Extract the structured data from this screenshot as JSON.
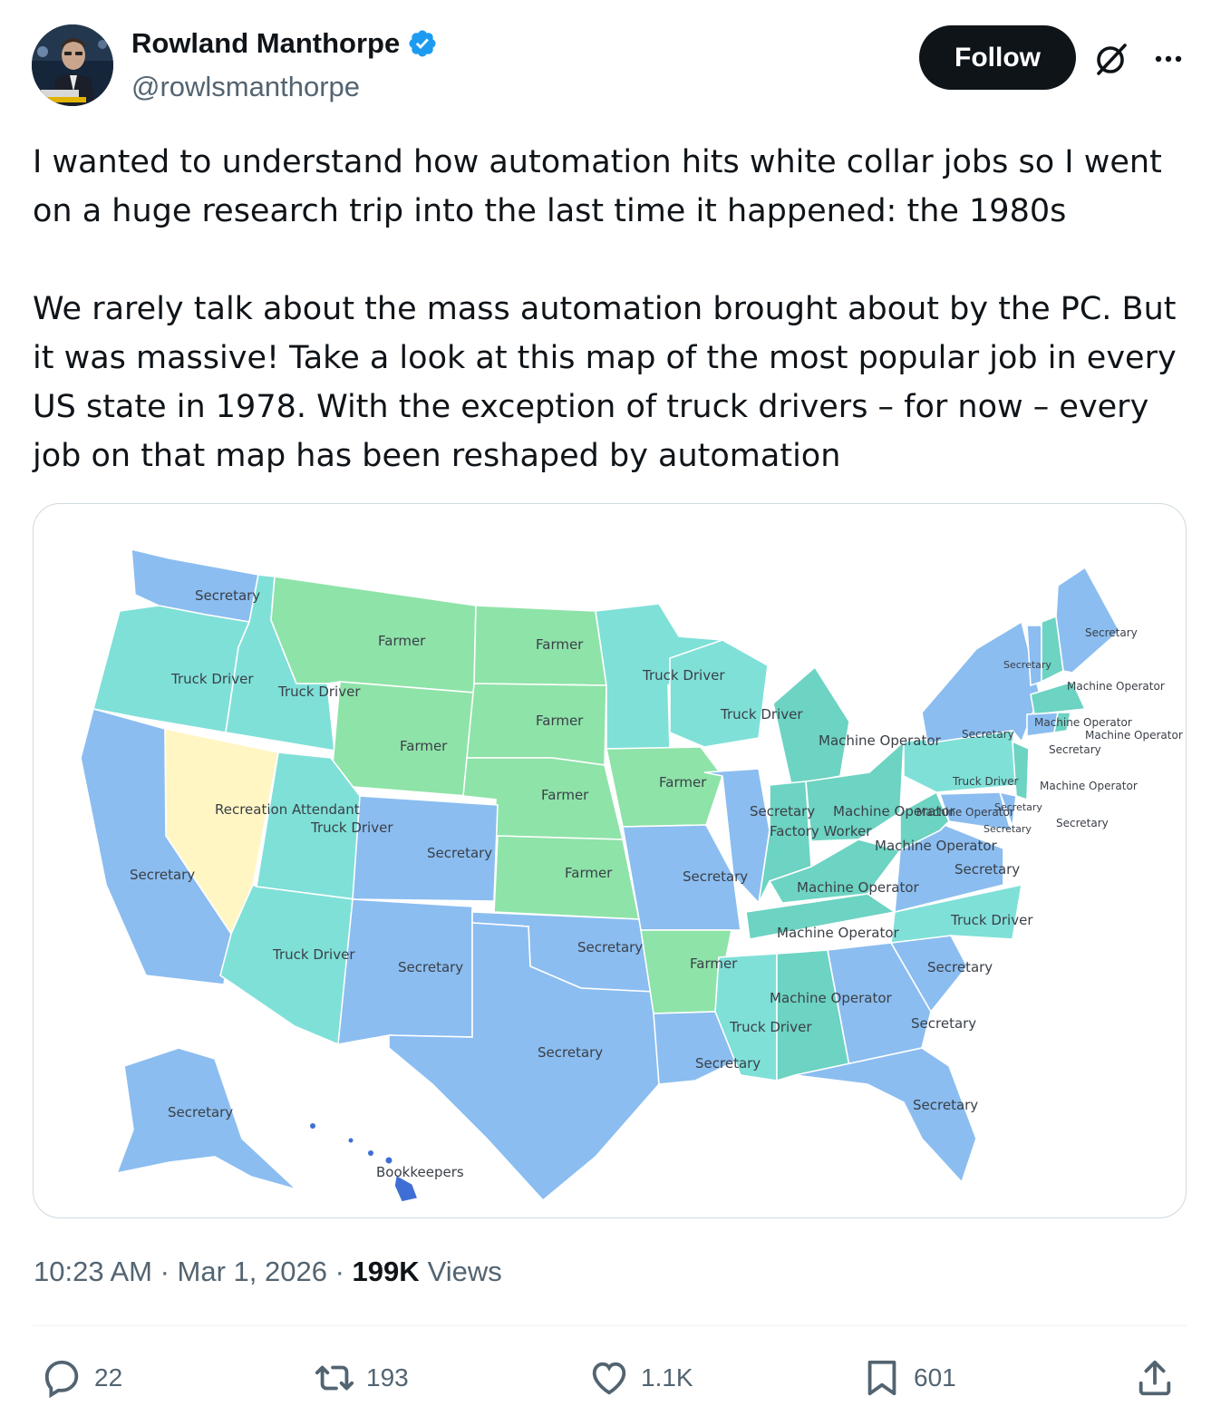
{
  "author": {
    "display_name": "Rowland Manthorpe",
    "handle": "@rowlsmanthorpe",
    "verified": true
  },
  "follow_label": "Follow",
  "tweet": {
    "paragraph_1": "I wanted to understand how automation hits white collar jobs so I went on a huge research trip into the last time it happened: the 1980s",
    "paragraph_2": "We rarely talk about the mass automation brought about by the PC. But it was massive! Take a look at this map of the most popular job in every US state in 1978. With the exception of truck drivers – for now – every job on that map has been reshaped by automation"
  },
  "map": {
    "colors": {
      "Secretary": "#8bbdf0",
      "Truck Driver": "#7fe0d8",
      "Farmer": "#8ee3a8",
      "Machine Operator": "#6dd3c2",
      "Recreation Attendant": "#fff6c4",
      "Bookkeepers": "#3f6fd4"
    },
    "labels": [
      {
        "state": "WA",
        "job": "Secretary"
      },
      {
        "state": "OR",
        "job": "Truck Driver"
      },
      {
        "state": "ID",
        "job": "Truck Driver"
      },
      {
        "state": "MT",
        "job": "Farmer"
      },
      {
        "state": "ND",
        "job": "Farmer"
      },
      {
        "state": "MN",
        "job": "Truck Driver"
      },
      {
        "state": "SD",
        "job": "Farmer"
      },
      {
        "state": "WY",
        "job": "Farmer"
      },
      {
        "state": "WI",
        "job": "Truck Driver"
      },
      {
        "state": "MI",
        "job": "Machine Operator"
      },
      {
        "state": "NE",
        "job": "Farmer"
      },
      {
        "state": "IA",
        "job": "Farmer"
      },
      {
        "state": "NV",
        "job": "Recreation Attendant"
      },
      {
        "state": "UT",
        "job": "Truck Driver"
      },
      {
        "state": "CA",
        "job": "Secretary"
      },
      {
        "state": "CO",
        "job": "Secretary"
      },
      {
        "state": "KS",
        "job": "Farmer"
      },
      {
        "state": "MO",
        "job": "Secretary"
      },
      {
        "state": "IL",
        "job": "Secretary"
      },
      {
        "state": "IN",
        "job": "Machine Operator"
      },
      {
        "state": "IN2",
        "job": "Factory Worker"
      },
      {
        "state": "OH",
        "job": "Machine Operator"
      },
      {
        "state": "KY",
        "job": "Machine Operator"
      },
      {
        "state": "WV",
        "job": "Machine Operator"
      },
      {
        "state": "VA",
        "job": "Secretary"
      },
      {
        "state": "TN",
        "job": "Machine Operator"
      },
      {
        "state": "NC",
        "job": "Truck Driver"
      },
      {
        "state": "AZ",
        "job": "Truck Driver"
      },
      {
        "state": "NM",
        "job": "Secretary"
      },
      {
        "state": "OK",
        "job": "Secretary"
      },
      {
        "state": "AR",
        "job": "Farmer"
      },
      {
        "state": "TX",
        "job": "Secretary"
      },
      {
        "state": "LA",
        "job": "Secretary"
      },
      {
        "state": "MS",
        "job": "Truck Driver"
      },
      {
        "state": "AL",
        "job": "Machine Operator"
      },
      {
        "state": "GA",
        "job": "Secretary"
      },
      {
        "state": "SC",
        "job": "Secretary"
      },
      {
        "state": "FL",
        "job": "Secretary"
      },
      {
        "state": "AK",
        "job": "Secretary"
      },
      {
        "state": "HI",
        "job": "Bookkeepers"
      },
      {
        "state": "ME",
        "job": "Secretary"
      },
      {
        "state": "VT",
        "job": "Secretary"
      },
      {
        "state": "NH",
        "job": "Machine Operator"
      },
      {
        "state": "NY",
        "job": "Secretary"
      },
      {
        "state": "MA",
        "job": "Machine Operator"
      },
      {
        "state": "RI",
        "job": "Machine Operator"
      },
      {
        "state": "CT",
        "job": "Secretary"
      },
      {
        "state": "PA",
        "job": "Truck Driver"
      },
      {
        "state": "NJ",
        "job": "Machine Operator"
      },
      {
        "state": "DE",
        "job": "Secretary"
      },
      {
        "state": "MD",
        "job": "Secretary"
      },
      {
        "state": "DC",
        "job": "Secretary"
      }
    ]
  },
  "meta": {
    "time": "10:23 AM",
    "separator": " · ",
    "date": "Mar 1, 2026",
    "views_count": "199K",
    "views_label": "Views"
  },
  "actions": {
    "replies": "22",
    "reposts": "193",
    "likes": "1.1K",
    "bookmarks": "601"
  },
  "icons": [
    "verified-badge-icon",
    "grok-icon",
    "more-icon",
    "reply-icon",
    "repost-icon",
    "like-icon",
    "bookmark-icon",
    "share-icon"
  ]
}
